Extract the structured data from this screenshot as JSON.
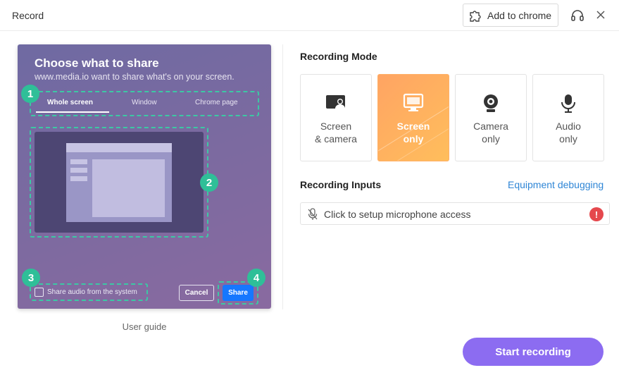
{
  "window": {
    "title": "Record"
  },
  "header": {
    "add_to_chrome_label": "Add to chrome",
    "icons": [
      "puzzle-icon",
      "headset-icon",
      "close-icon"
    ]
  },
  "guide": {
    "title": "Choose what to share",
    "subtitle": "www.media.io want to share what's on your screen.",
    "tabs": [
      {
        "label": "Whole screen",
        "active": true
      },
      {
        "label": "Window",
        "active": false
      },
      {
        "label": "Chrome page",
        "active": false
      }
    ],
    "share_audio_label": "Share audio from the system",
    "cancel_label": "Cancel",
    "share_label": "Share",
    "badges": [
      "1",
      "2",
      "3",
      "4"
    ],
    "user_guide_label": "User guide"
  },
  "recording_mode": {
    "title": "Recording Mode",
    "modes": [
      {
        "line1": "Screen",
        "line2": "& camera",
        "icon": "screen-camera-icon",
        "selected": false
      },
      {
        "line1": "Screen",
        "line2": "only",
        "icon": "monitor-icon",
        "selected": true
      },
      {
        "line1": "Camera",
        "line2": "only",
        "icon": "webcam-icon",
        "selected": false
      },
      {
        "line1": "Audio",
        "line2": "only",
        "icon": "microphone-icon",
        "selected": false
      }
    ]
  },
  "recording_inputs": {
    "title": "Recording Inputs",
    "equipment_link": "Equipment debugging",
    "mic_placeholder": "Click to setup microphone access",
    "alert_symbol": "!"
  },
  "start_button_label": "Start recording",
  "colors": {
    "accent_purple": "#8c6cf1",
    "selected_orange": "#ffa463",
    "link_blue": "#2f86d6",
    "badge_green": "#2fbf98",
    "alert_red": "#e5484d"
  }
}
